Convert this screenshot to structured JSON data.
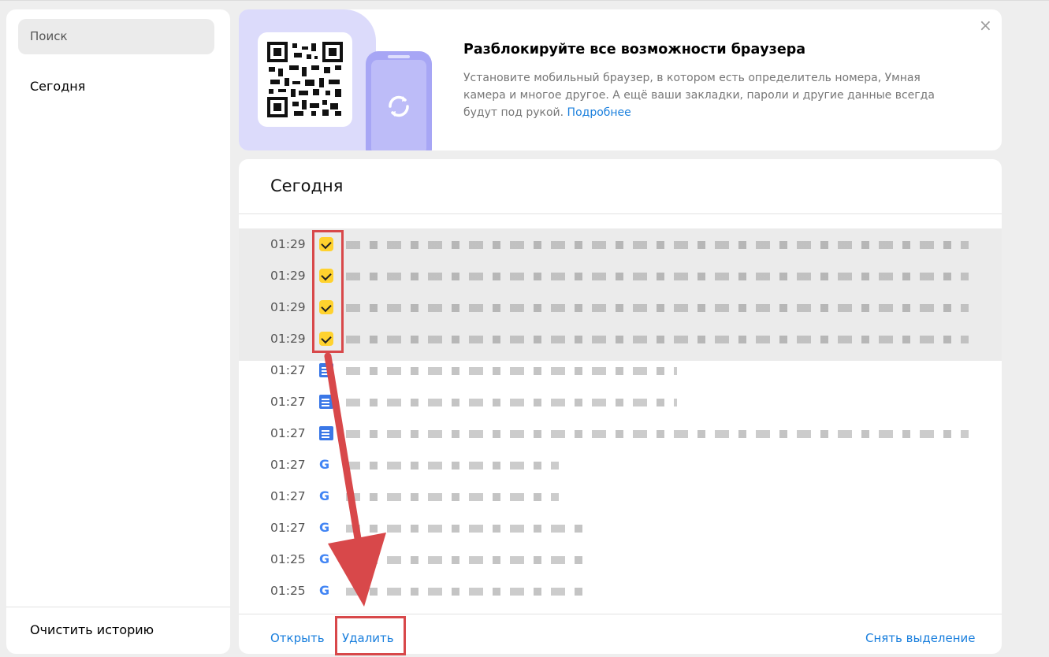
{
  "sidebar": {
    "search_placeholder": "Поиск",
    "today_label": "Сегодня",
    "clear_history_label": "Очистить историю"
  },
  "promo": {
    "title": "Разблокируйте все возможности браузера",
    "text": "Установите мобильный браузер, в котором есть определитель номера, Умная камера и многое другое. А ещё ваши закладки, пароли и другие данные всегда будут под рукой.",
    "link_label": "Подробнее",
    "close_label": "×"
  },
  "history": {
    "title": "Сегодня",
    "rows": [
      {
        "time": "01:29",
        "icon": "checkbox-checked-icon",
        "selected": true
      },
      {
        "time": "01:29",
        "icon": "checkbox-checked-icon",
        "selected": true
      },
      {
        "time": "01:29",
        "icon": "checkbox-checked-icon",
        "selected": true
      },
      {
        "time": "01:29",
        "icon": "checkbox-checked-icon",
        "selected": true
      },
      {
        "time": "01:27",
        "icon": "google-docs-icon",
        "selected": false
      },
      {
        "time": "01:27",
        "icon": "google-docs-icon",
        "selected": false
      },
      {
        "time": "01:27",
        "icon": "google-docs-icon",
        "selected": false
      },
      {
        "time": "01:27",
        "icon": "google-icon",
        "selected": false
      },
      {
        "time": "01:27",
        "icon": "google-icon",
        "selected": false
      },
      {
        "time": "01:27",
        "icon": "google-icon",
        "selected": false
      },
      {
        "time": "01:25",
        "icon": "google-icon",
        "selected": false
      },
      {
        "time": "01:25",
        "icon": "google-icon",
        "selected": false
      }
    ]
  },
  "footer": {
    "open_label": "Открыть",
    "delete_label": "Удалить",
    "deselect_label": "Снять выделение"
  },
  "colors": {
    "accent_link": "#1a7fdd",
    "checkbox": "#ffd22e",
    "annotation_red": "#d8484a",
    "promo_bg": "#dcdbfb"
  }
}
